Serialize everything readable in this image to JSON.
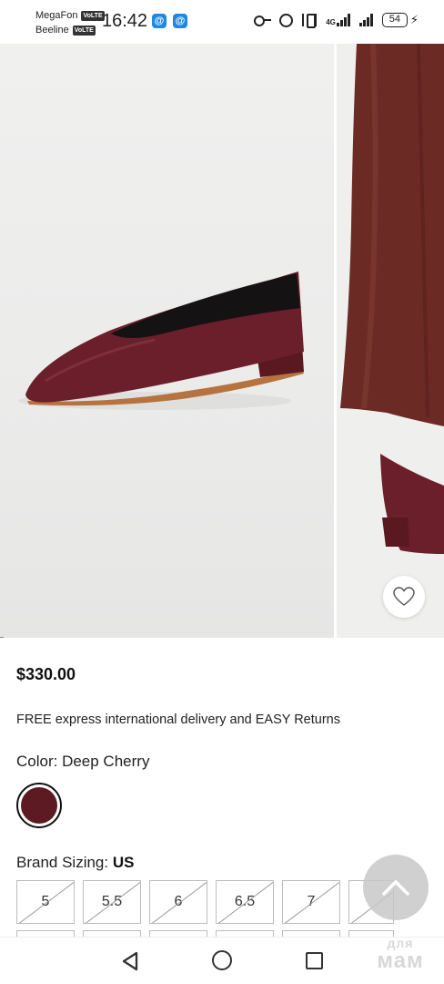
{
  "status_bar": {
    "carrier_1": "MegaFon",
    "carrier_2": "Beeline",
    "volte_badge": "VoLTE",
    "time": "16:42",
    "notif_glyph": "@",
    "network_type": "4G",
    "battery_level": "54"
  },
  "product": {
    "price": "$330.00",
    "delivery_note": "FREE express international delivery and EASY Returns",
    "color_label": "Color: Deep Cherry",
    "swatch_color": "#5e1a22",
    "sizing_label": "Brand Sizing:",
    "sizing_system": "US",
    "sizes": [
      "5",
      "5.5",
      "6",
      "6.5",
      "7",
      ""
    ]
  },
  "gallery": {
    "images": [
      "shoe-side-view",
      "shoe-on-model"
    ],
    "shoe_color": "#6a1f2b"
  },
  "watermark": {
    "line_1": "для",
    "line_2": "мам"
  },
  "icons": {
    "wishlist": "heart-icon",
    "scroll_top": "chevron-up-icon",
    "nav_back": "back-triangle-icon",
    "nav_home": "home-circle-icon",
    "nav_recent": "recents-square-icon"
  }
}
